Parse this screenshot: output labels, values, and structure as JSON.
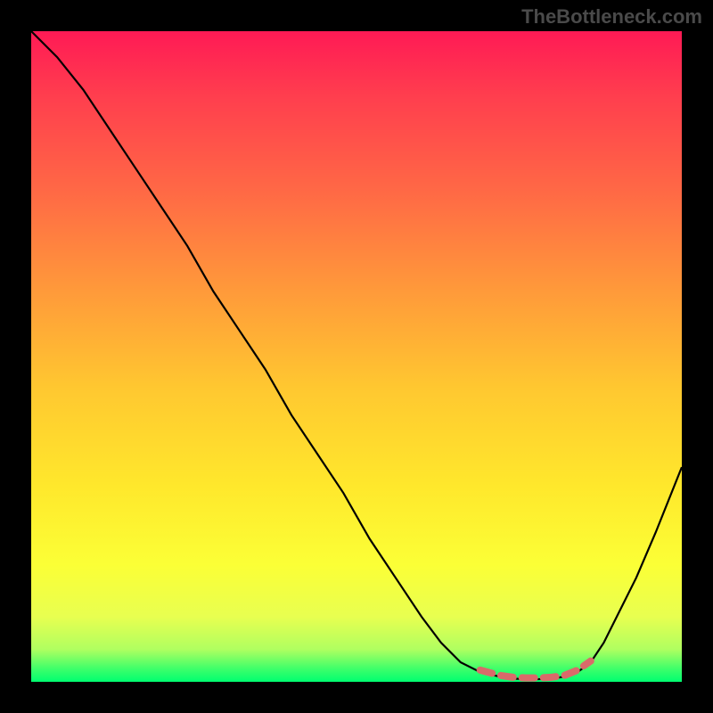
{
  "attribution": "TheBottleneck.com",
  "chart_data": {
    "type": "line",
    "title": "",
    "xlabel": "",
    "ylabel": "",
    "xlim": [
      0,
      100
    ],
    "ylim": [
      0,
      100
    ],
    "grid": false,
    "legend": false,
    "background_gradient": {
      "direction": "vertical",
      "stops": [
        {
          "pos": 0,
          "color": "#ff1a55"
        },
        {
          "pos": 25,
          "color": "#ff6a45"
        },
        {
          "pos": 55,
          "color": "#ffc830"
        },
        {
          "pos": 82,
          "color": "#fbff36"
        },
        {
          "pos": 100,
          "color": "#00ff70"
        }
      ]
    },
    "series": [
      {
        "name": "bottleneck-curve",
        "color": "#000000",
        "x": [
          0,
          4,
          8,
          12,
          16,
          20,
          24,
          28,
          32,
          36,
          40,
          44,
          48,
          52,
          56,
          60,
          63,
          66,
          69,
          72,
          74,
          76,
          78,
          80,
          82,
          84,
          86,
          88,
          90,
          93,
          96,
          100
        ],
        "y": [
          100,
          96,
          91,
          85,
          79,
          73,
          67,
          60,
          54,
          48,
          41,
          35,
          29,
          22,
          16,
          10,
          6,
          3,
          1.5,
          0.8,
          0.5,
          0.4,
          0.4,
          0.5,
          0.8,
          1.5,
          3,
          6,
          10,
          16,
          23,
          33
        ]
      },
      {
        "name": "optimal-range-marker",
        "color": "#d96a6a",
        "style": "dashed-thick",
        "x": [
          69,
          72,
          74,
          76,
          78,
          80,
          82,
          84,
          86
        ],
        "y": [
          1.8,
          1.0,
          0.7,
          0.6,
          0.6,
          0.7,
          1.0,
          1.8,
          3.2
        ]
      }
    ],
    "annotations": []
  }
}
